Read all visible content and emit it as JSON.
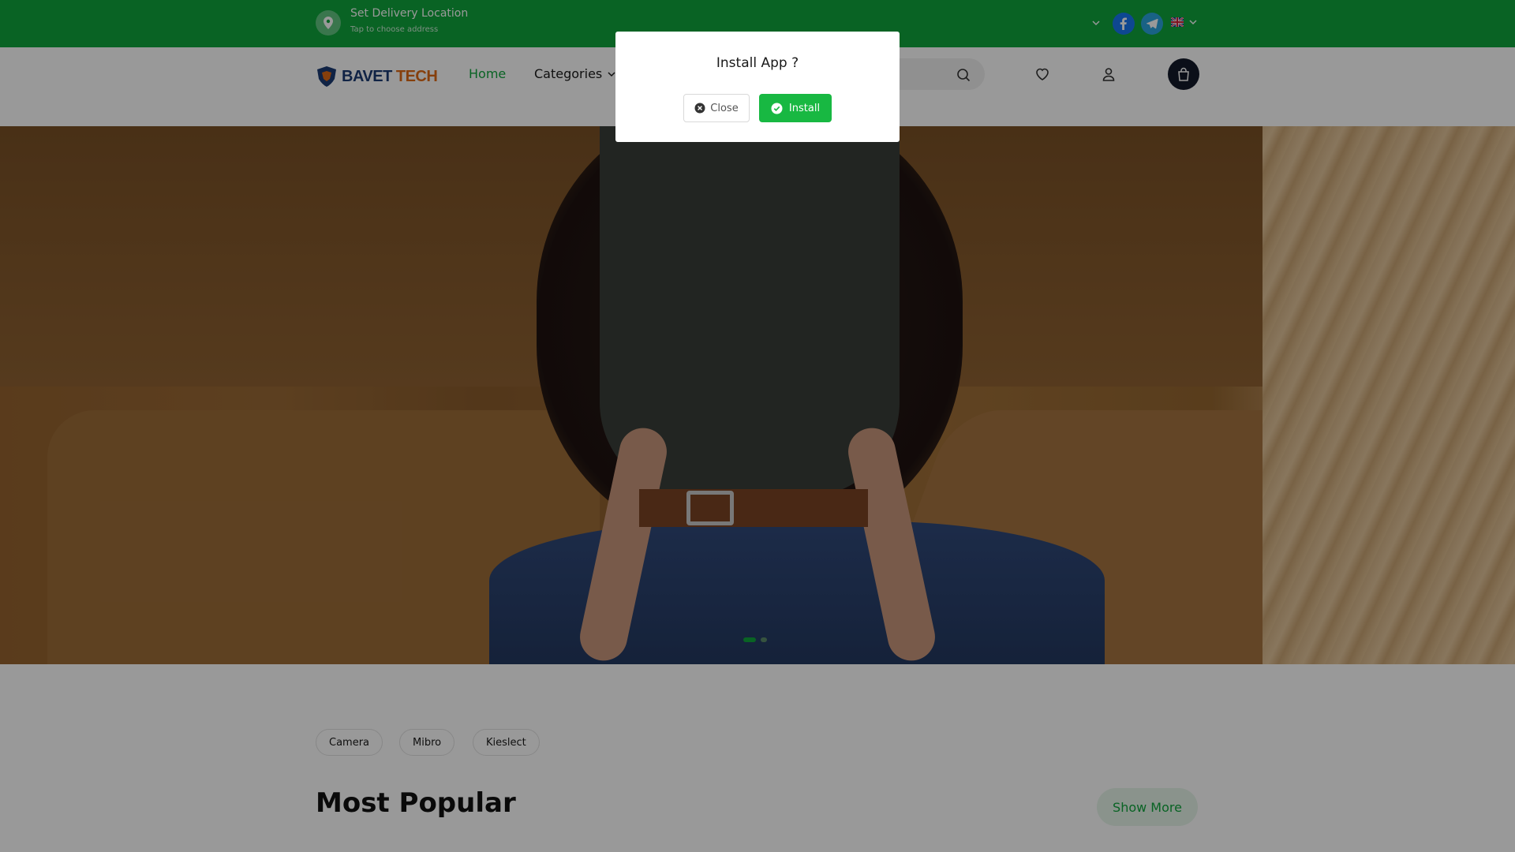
{
  "topbar": {
    "location_title": "Set Delivery Location",
    "location_subtitle": "Tap to choose address",
    "location_icon": "map-pin-icon",
    "social": [
      "facebook-icon",
      "telegram-icon"
    ],
    "language_icon": "uk-flag-icon"
  },
  "header": {
    "logo_part1": "BAVET",
    "logo_part2": "TECH",
    "nav": {
      "home": "Home",
      "categories": "Categories"
    },
    "search_icon": "search-icon",
    "wishlist_icon": "heart-icon",
    "account_icon": "user-icon",
    "cart_icon": "shopping-bag-icon"
  },
  "hero": {
    "slides_total": 2,
    "active_slide": 1
  },
  "tags": [
    "Camera",
    "Mibro",
    "Kieslect"
  ],
  "section": {
    "title": "Most Popular",
    "show_more": "Show More"
  },
  "modal": {
    "title": "Install App ?",
    "close_label": "Close",
    "install_label": "Install"
  },
  "colors": {
    "brand_green": "#0fa63c",
    "install_green": "#18b842",
    "logo_blue": "#1b3b73",
    "logo_orange": "#e06a14",
    "cart_dark": "#131a2a"
  }
}
